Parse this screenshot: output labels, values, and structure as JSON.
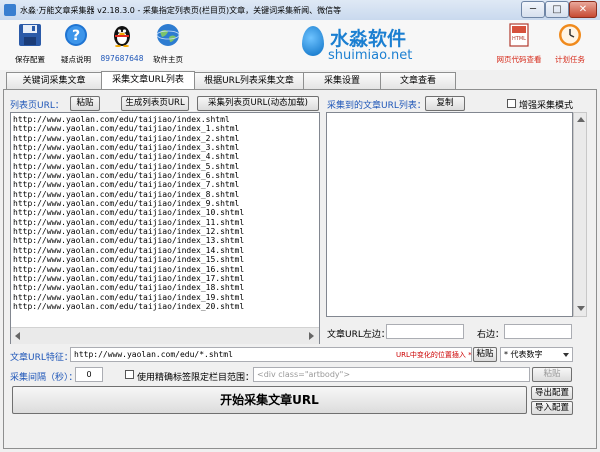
{
  "window": {
    "title": "水淼·万能文章采集器 v2.18.3.0 - 采集指定列表页(栏目页)文章，关键词采集新闻、微信等",
    "min": "─",
    "max": "□",
    "close": "✕"
  },
  "toolbar": {
    "save": "保存配置",
    "help": "疑点说明",
    "qq": "897687648",
    "home": "软件主页",
    "view_source": "网页代码查看",
    "schedule": "计划任务"
  },
  "logo": {
    "cn": "水淼软件",
    "en": "shuimiao.net"
  },
  "tabs": [
    {
      "label": "关键词采集文章",
      "active": false
    },
    {
      "label": "采集文章URL列表",
      "active": true
    },
    {
      "label": "根据URL列表采集文章",
      "active": false
    },
    {
      "label": "采集设置",
      "active": false
    },
    {
      "label": "文章查看",
      "active": false
    }
  ],
  "left": {
    "label": "列表页URL：",
    "paste": "粘贴",
    "gen": "生成列表页URL",
    "collect": "采集列表页URL(动态加载)",
    "urls": [
      "http://www.yaolan.com/edu/taijiao/index.shtml",
      "http://www.yaolan.com/edu/taijiao/index_1.shtml",
      "http://www.yaolan.com/edu/taijiao/index_2.shtml",
      "http://www.yaolan.com/edu/taijiao/index_3.shtml",
      "http://www.yaolan.com/edu/taijiao/index_4.shtml",
      "http://www.yaolan.com/edu/taijiao/index_5.shtml",
      "http://www.yaolan.com/edu/taijiao/index_6.shtml",
      "http://www.yaolan.com/edu/taijiao/index_7.shtml",
      "http://www.yaolan.com/edu/taijiao/index_8.shtml",
      "http://www.yaolan.com/edu/taijiao/index_9.shtml",
      "http://www.yaolan.com/edu/taijiao/index_10.shtml",
      "http://www.yaolan.com/edu/taijiao/index_11.shtml",
      "http://www.yaolan.com/edu/taijiao/index_12.shtml",
      "http://www.yaolan.com/edu/taijiao/index_13.shtml",
      "http://www.yaolan.com/edu/taijiao/index_14.shtml",
      "http://www.yaolan.com/edu/taijiao/index_15.shtml",
      "http://www.yaolan.com/edu/taijiao/index_16.shtml",
      "http://www.yaolan.com/edu/taijiao/index_17.shtml",
      "http://www.yaolan.com/edu/taijiao/index_18.shtml",
      "http://www.yaolan.com/edu/taijiao/index_19.shtml",
      "http://www.yaolan.com/edu/taijiao/index_20.shtml"
    ]
  },
  "right": {
    "label": "采集到的文章URL列表：",
    "copy": "复制",
    "enhanced": "增强采集模式",
    "left_label": "文章URL左边：",
    "right_label": "右边："
  },
  "feature": {
    "label": "文章URL特征：",
    "value": "http://www.yaolan.com/edu/*.shtml",
    "hint": "URL中变化的位置插入 *",
    "paste": "粘贴",
    "select": "* 代表数字"
  },
  "interval": {
    "label": "采集间隔（秒）：",
    "value": "0",
    "precise": "使用精确标签限定栏目范围：",
    "placeholder": "<div class=\"artbody\">",
    "paste": "粘贴"
  },
  "start": "开始采集文章URL",
  "export": "导出配置",
  "import": "导入配置",
  "colors": {
    "title_text": "#1e56b8",
    "hint_red": "#cc0000"
  }
}
